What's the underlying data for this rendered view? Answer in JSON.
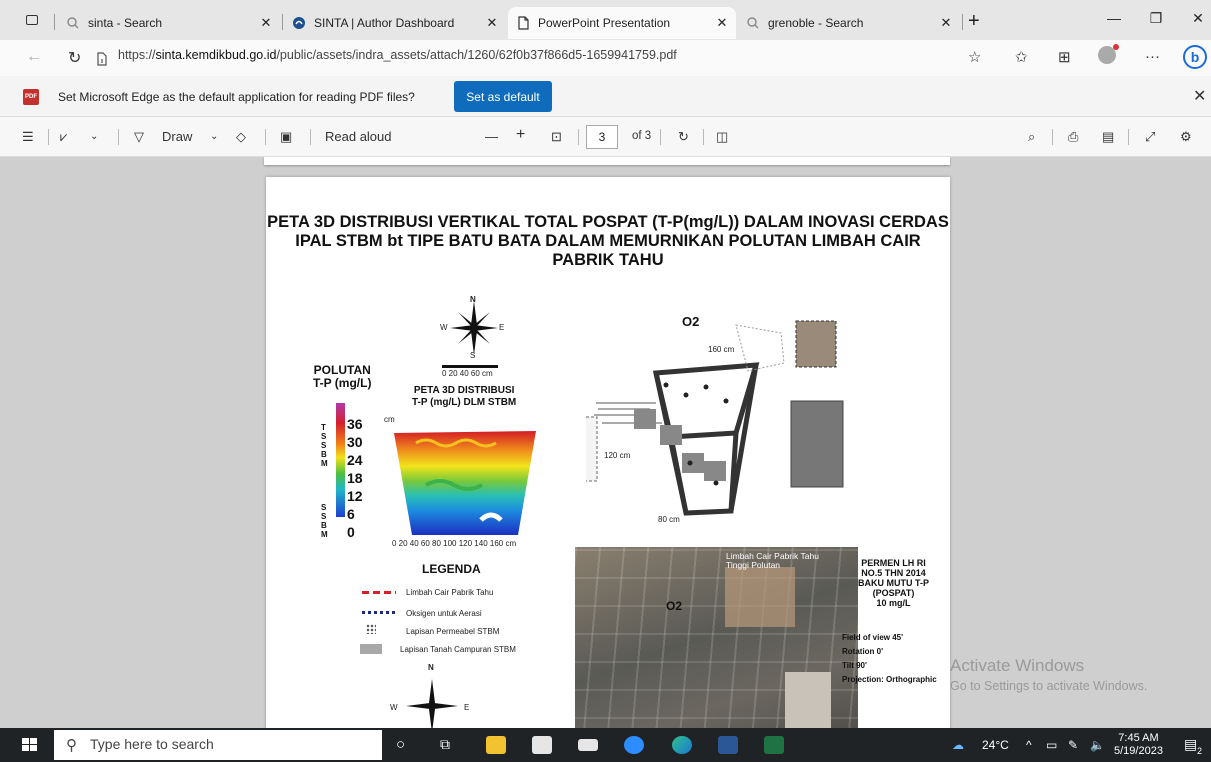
{
  "browser": {
    "tabs": [
      {
        "label": "sinta - Search",
        "icon": "search-icon"
      },
      {
        "label": "SINTA | Author Dashboard",
        "icon": "sinta-icon"
      },
      {
        "label": "PowerPoint Presentation",
        "icon": "document-icon"
      },
      {
        "label": "grenoble - Search",
        "icon": "search-icon"
      }
    ],
    "active_tab": 2,
    "url_prefix": "https://",
    "url_domain": "sinta.kemdikbud.go.id",
    "url_path": "/public/assets/indra_assets/attach/1260/62f0b37f866d5-1659941759.pdf"
  },
  "infobar": {
    "message": "Set Microsoft Edge as the default application for reading PDF files?",
    "button_label": "Set as default"
  },
  "pdf_toolbar": {
    "draw_label": "Draw",
    "read_aloud_label": "Read aloud",
    "page_current": "3",
    "page_total_label": "of 3"
  },
  "pdf_page": {
    "title": "PETA 3D DISTRIBUSI VERTIKAL TOTAL POSPAT (T-P(mg/L)) DALAM INOVASI CERDAS IPAL STBM bt TIPE BATU BATA DALAM MEMURNIKAN POLUTAN LIMBAH CAIR PABRIK TAHU",
    "compass": {
      "n": "N",
      "s": "S",
      "e": "E",
      "w": "W"
    },
    "scale_label": "0  20  40  60 cm",
    "polutan_label": "POLUTAN\nT-P (mg/L)",
    "peta_label": "PETA 3D DISTRIBUSI\nT-P (mg/L) DLM STBM",
    "colorbar_values": [
      "36",
      "30",
      "24",
      "18",
      "12",
      "6",
      "0"
    ],
    "tssbm_top": "T\nS\nS\nB\nM",
    "ssbm_bottom": "S\nS\nB\nM",
    "depth_unit": "cm",
    "x_axis_ticks": "0   20   40   60   80   100  120  140  160 cm",
    "x_axis_end": "160 cm",
    "o2_label": "O2",
    "dim_160": "160 cm",
    "dim_120": "120 cm",
    "dim_80": "80 cm",
    "legend_title": "LEGENDA",
    "legend_items": [
      "Limbah Cair Pabrik Tahu",
      "Oksigen untuk Aerasi",
      "Lapisan Permeabel STBM",
      "Lapisan Tanah Campuran STBM"
    ],
    "photo_label": "Limbah Cair Pabrik Tahu\nTinggi Polutan",
    "photo_o2": "O2",
    "permen_label": "PERMEN LH RI\nNO.5 THN 2014\nBAKU MUTU T-P\n(POSPAT)\n10 mg/L",
    "view_info": "Field of view 45'\nRotation 0'\nTilt 90'\nProjection: Orthographic"
  },
  "watermark": {
    "line1": "Activate Windows",
    "line2": "Go to Settings to activate Windows."
  },
  "taskbar": {
    "search_placeholder": "Type here to search",
    "weather": "24°C",
    "time": "7:45 AM",
    "date": "5/19/2023",
    "notification_count": "2"
  },
  "colors": {
    "accent": "#0f6cbd",
    "taskbar": "#1f2326"
  }
}
